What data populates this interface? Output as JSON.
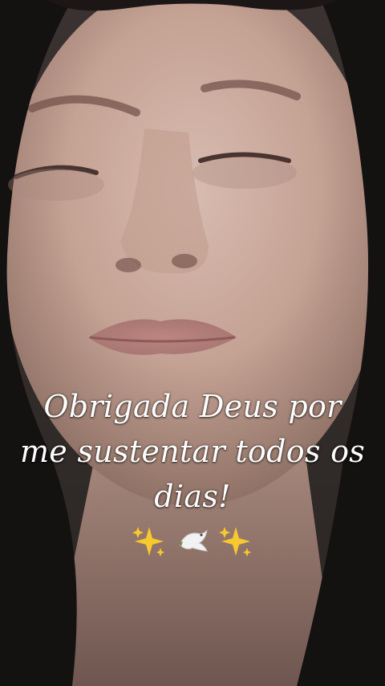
{
  "caption": {
    "line1": "Obrigada Deus por",
    "line2": "me sustentar todos os",
    "line3": "dias!"
  },
  "emojis": {
    "left": "sparkles-icon",
    "center": "dove-icon",
    "right": "sparkles-icon",
    "sparkle_color": "#f7c82f",
    "dove_color": "#f2f2f2"
  },
  "colors": {
    "caption_text": "#ffffff",
    "background_dark": "#1a1716",
    "skin_tone": "#c9a99a",
    "lip_tone": "#b07a74"
  }
}
